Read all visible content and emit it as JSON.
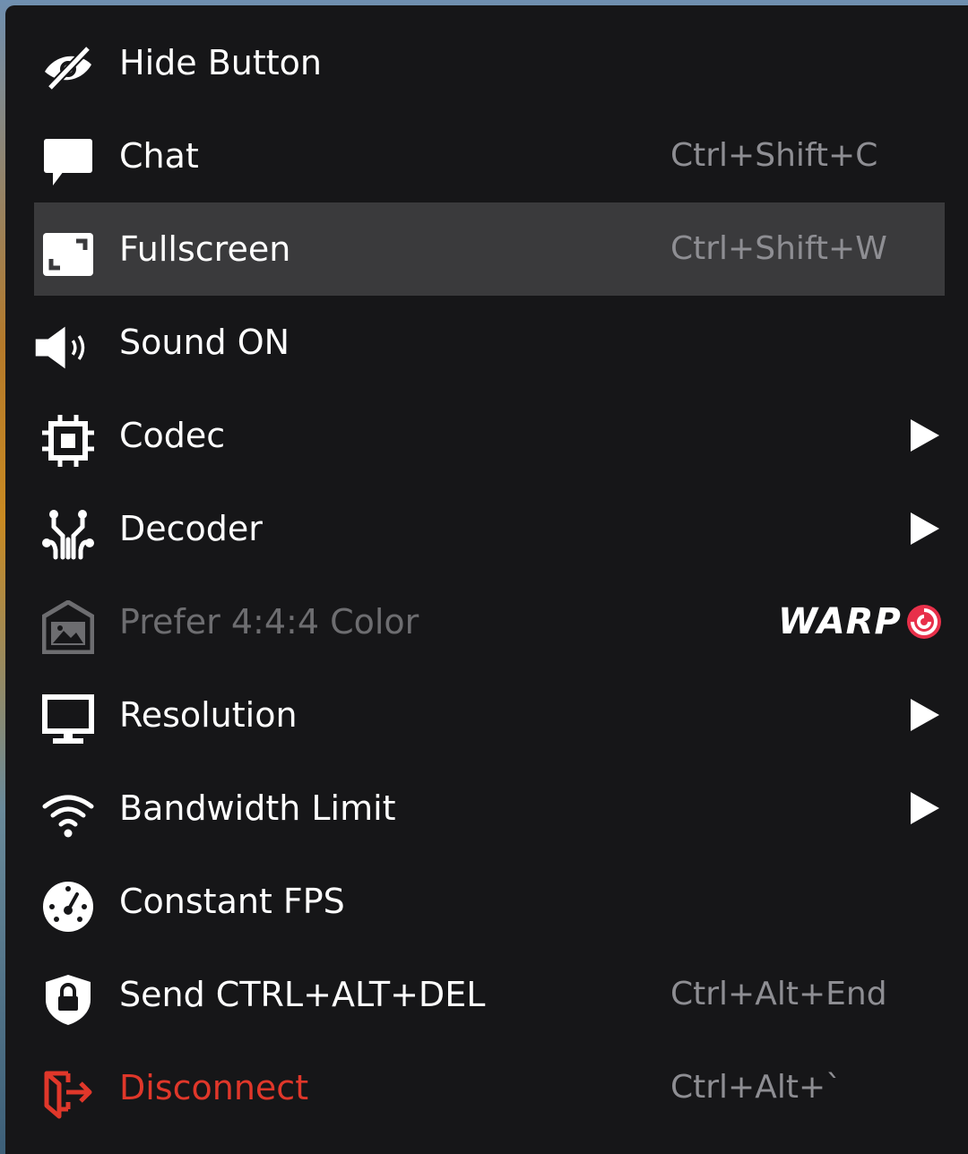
{
  "menu": {
    "items": [
      {
        "label": "Hide Button",
        "shortcut": "",
        "icon": "eye-off-icon"
      },
      {
        "label": "Chat",
        "shortcut": "Ctrl+Shift+C",
        "icon": "chat-bubble-icon"
      },
      {
        "label": "Fullscreen",
        "shortcut": "Ctrl+Shift+W",
        "icon": "fullscreen-icon",
        "highlighted": true
      },
      {
        "label": "Sound ON",
        "shortcut": "",
        "icon": "speaker-icon"
      },
      {
        "label": "Codec",
        "shortcut": "",
        "icon": "chip-icon",
        "submenu": true
      },
      {
        "label": "Decoder",
        "shortcut": "",
        "icon": "decoder-icon",
        "submenu": true
      },
      {
        "label": "Prefer 4:4:4 Color",
        "shortcut": "",
        "icon": "image-color-icon",
        "disabled": true,
        "badge": "WARP"
      },
      {
        "label": "Resolution",
        "shortcut": "",
        "icon": "monitor-icon",
        "submenu": true
      },
      {
        "label": "Bandwidth Limit",
        "shortcut": "",
        "icon": "wifi-icon",
        "submenu": true
      },
      {
        "label": "Constant FPS",
        "shortcut": "",
        "icon": "speedometer-icon"
      },
      {
        "label": "Send CTRL+ALT+DEL",
        "shortcut": "Ctrl+Alt+End",
        "icon": "shield-lock-icon"
      },
      {
        "label": "Disconnect",
        "shortcut": "Ctrl+Alt+`",
        "icon": "exit-icon",
        "danger": true
      }
    ]
  },
  "colors": {
    "menu_bg": "#161618",
    "highlight_bg": "#3a3a3c",
    "text": "#ffffff",
    "shortcut_text": "#8e8e93",
    "disabled_text": "#6d6d70",
    "danger": "#e0372a",
    "warp_accent": "#e8304a"
  }
}
